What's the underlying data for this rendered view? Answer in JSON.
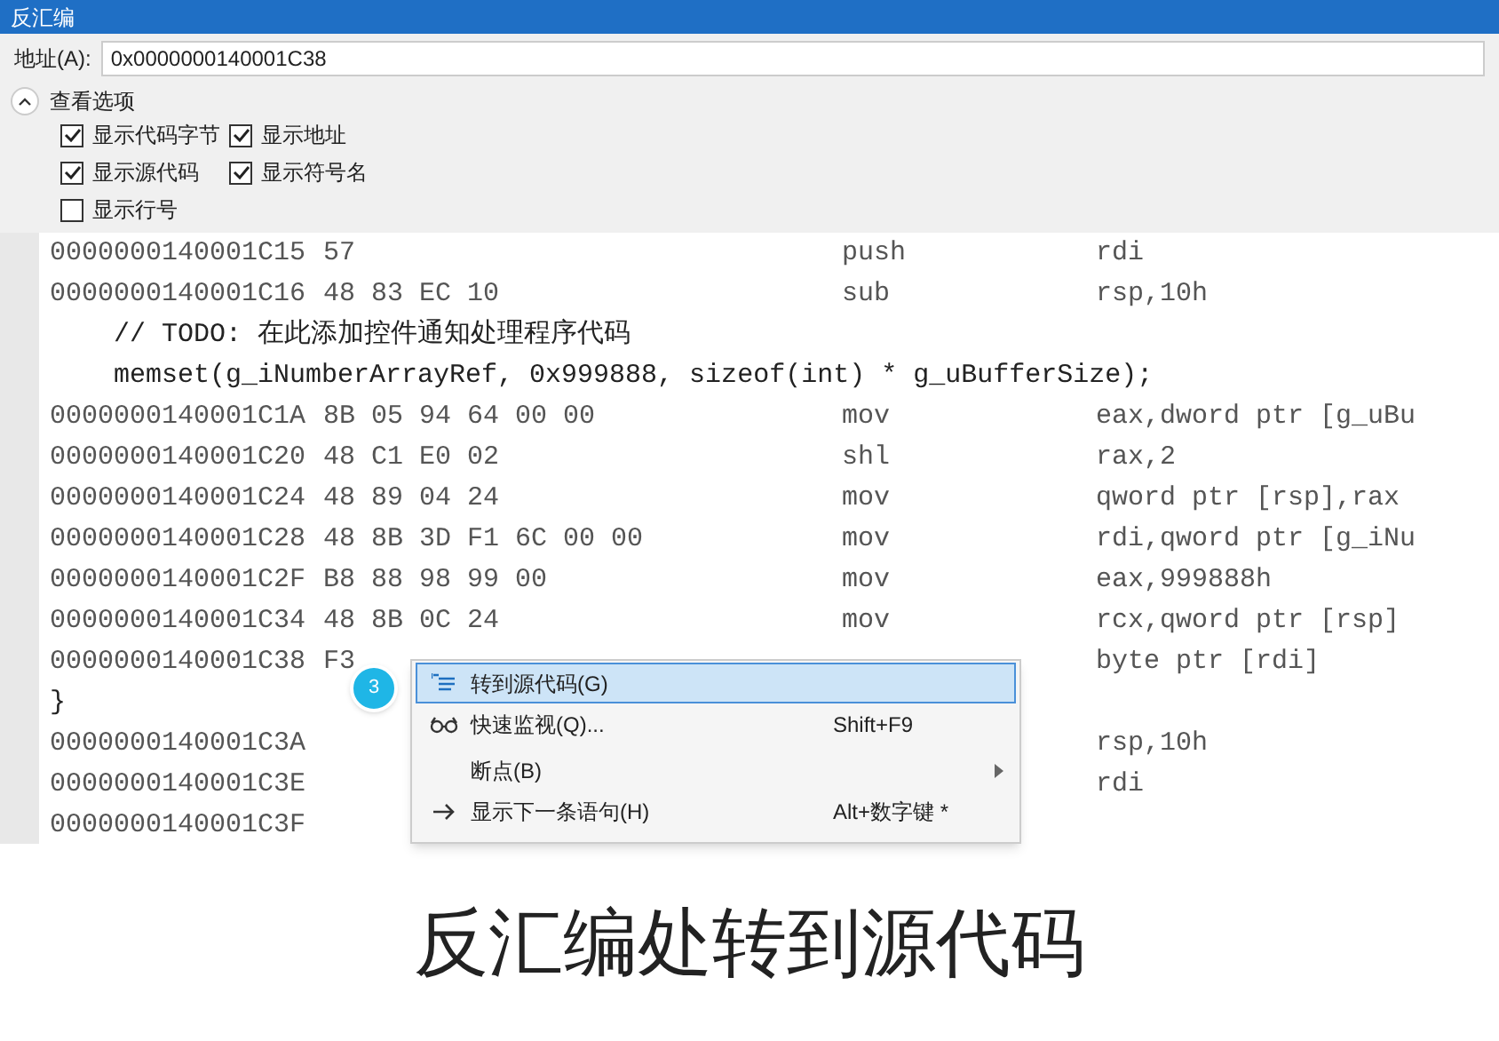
{
  "window": {
    "title": "反汇编"
  },
  "address": {
    "label": "地址(A):",
    "value": "0x0000000140001C38"
  },
  "options": {
    "title": "查看选项",
    "expanded": true,
    "items": [
      {
        "label": "显示代码字节",
        "checked": true
      },
      {
        "label": "显示地址",
        "checked": true
      },
      {
        "label": "显示源代码",
        "checked": true
      },
      {
        "label": "显示符号名",
        "checked": true
      },
      {
        "label": "显示行号",
        "checked": false
      }
    ]
  },
  "code": [
    {
      "kind": "asm",
      "address": "0000000140001C15",
      "bytes": "57",
      "mnemonic": "push",
      "operands": "rdi"
    },
    {
      "kind": "asm",
      "address": "0000000140001C16",
      "bytes": "48 83 EC 10",
      "mnemonic": "sub",
      "operands": "rsp,10h"
    },
    {
      "kind": "source",
      "text": "    // TODO: 在此添加控件通知处理程序代码"
    },
    {
      "kind": "source",
      "text": "    memset(g_iNumberArrayRef, 0x999888, sizeof(int) * g_uBufferSize);"
    },
    {
      "kind": "asm",
      "address": "0000000140001C1A",
      "bytes": "8B 05 94 64 00 00",
      "mnemonic": "mov",
      "operands": "eax,dword ptr [g_uBu"
    },
    {
      "kind": "asm",
      "address": "0000000140001C20",
      "bytes": "48 C1 E0 02",
      "mnemonic": "shl",
      "operands": "rax,2"
    },
    {
      "kind": "asm",
      "address": "0000000140001C24",
      "bytes": "48 89 04 24",
      "mnemonic": "mov",
      "operands": "qword ptr [rsp],rax"
    },
    {
      "kind": "asm",
      "address": "0000000140001C28",
      "bytes": "48 8B 3D F1 6C 00 00",
      "mnemonic": "mov",
      "operands": "rdi,qword ptr [g_iNu"
    },
    {
      "kind": "asm",
      "address": "0000000140001C2F",
      "bytes": "B8 88 98 99 00",
      "mnemonic": "mov",
      "operands": "eax,999888h"
    },
    {
      "kind": "asm",
      "address": "0000000140001C34",
      "bytes": "48 8B 0C 24",
      "mnemonic": "mov",
      "operands": "rcx,qword ptr [rsp]"
    },
    {
      "kind": "asm",
      "address": "0000000140001C38",
      "bytes": "F3",
      "operands": "byte ptr [rdi]"
    },
    {
      "kind": "source",
      "text": "}"
    },
    {
      "kind": "asm",
      "address": "0000000140001C3A",
      "operands": "rsp,10h"
    },
    {
      "kind": "asm",
      "address": "0000000140001C3E",
      "operands": "rdi"
    },
    {
      "kind": "asm",
      "address": "0000000140001C3F"
    }
  ],
  "context_menu": {
    "badge": "3",
    "items": [
      {
        "kind": "goto",
        "label": "转到源代码(G)",
        "selected": true
      },
      {
        "kind": "watch",
        "label": "快速监视(Q)...",
        "shortcut": "Shift+F9",
        "selected": false
      },
      {
        "kind": "submenu",
        "label": "断点(B)",
        "selected": false
      },
      {
        "kind": "next",
        "label": "显示下一条语句(H)",
        "shortcut": "Alt+数字键 *",
        "selected": false
      }
    ]
  },
  "caption": "反汇编处转到源代码"
}
